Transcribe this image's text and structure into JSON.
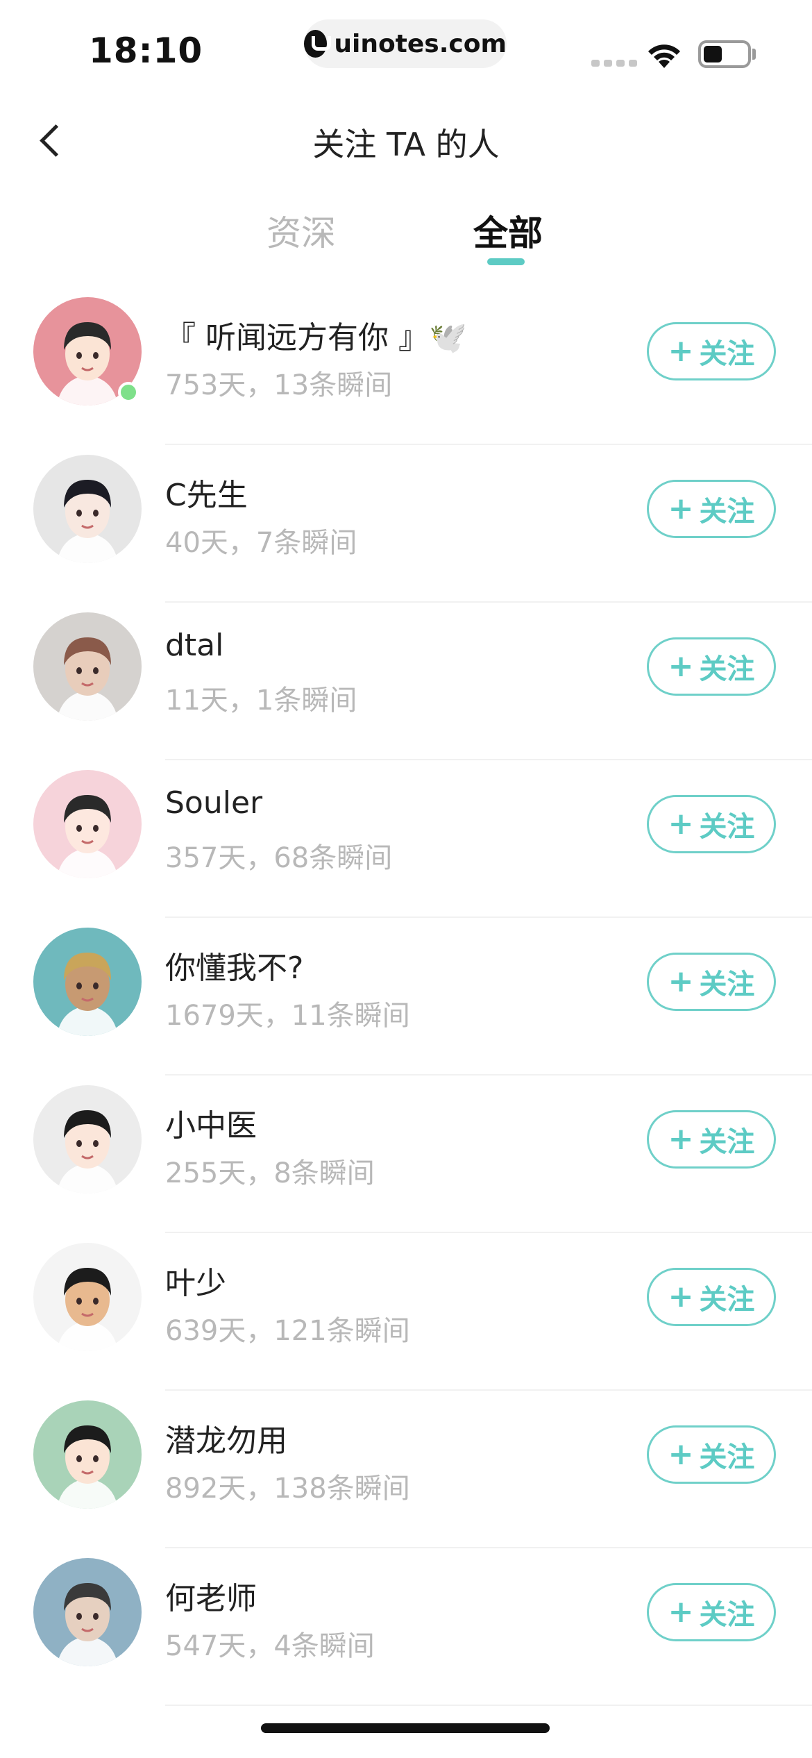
{
  "status_bar": {
    "time": "18:10",
    "url": "uinotes.com",
    "icons": [
      "cellular-signal-icon",
      "wifi-icon",
      "battery-icon"
    ]
  },
  "nav": {
    "title": "关注 TA 的人",
    "back_icon": "back-chevron-icon"
  },
  "tabs": [
    {
      "label": "资深",
      "active": false
    },
    {
      "label": "全部",
      "active": true
    }
  ],
  "follow_label": "关注",
  "users": [
    {
      "name": "『 听闻远方有你 』🕊️",
      "meta": "753天，13条瞬间",
      "online": true,
      "avatar_bg": "#e7939b",
      "hair": "#2a2a2a",
      "skin": "#fbe4d5"
    },
    {
      "name": "C先生",
      "meta": "40天，7条瞬间",
      "online": false,
      "avatar_bg": "#e6e6e6",
      "hair": "#1c1c24",
      "skin": "#f8e8e0"
    },
    {
      "name": "dtal",
      "meta": "11天，1条瞬间",
      "online": false,
      "avatar_bg": "#d5d2cf",
      "hair": "#8a5a4a",
      "skin": "#e8cdbb"
    },
    {
      "name": "Souler",
      "meta": "357天，68条瞬间",
      "online": false,
      "avatar_bg": "#f6d3da",
      "hair": "#2a2a2a",
      "skin": "#fde8df"
    },
    {
      "name": "你懂我不?",
      "meta": "1679天，11条瞬间",
      "online": false,
      "avatar_bg": "#6fb9bd",
      "hair": "#c9a55a",
      "skin": "#c79a72"
    },
    {
      "name": "小中医",
      "meta": "255天，8条瞬间",
      "online": false,
      "avatar_bg": "#ececec",
      "hair": "#1c1c1c",
      "skin": "#fbe6da"
    },
    {
      "name": "叶少",
      "meta": "639天，121条瞬间",
      "online": false,
      "avatar_bg": "#f4f4f4",
      "hair": "#1c1c1c",
      "skin": "#e8b98f"
    },
    {
      "name": "潜龙勿用",
      "meta": "892天，138条瞬间",
      "online": false,
      "avatar_bg": "#a9d3b8",
      "hair": "#1c1c1c",
      "skin": "#fbe4d5"
    },
    {
      "name": "何老师",
      "meta": "547天，4条瞬间",
      "online": false,
      "avatar_bg": "#8fb1c4",
      "hair": "#3a3a3a",
      "skin": "#e6d0c0"
    }
  ]
}
